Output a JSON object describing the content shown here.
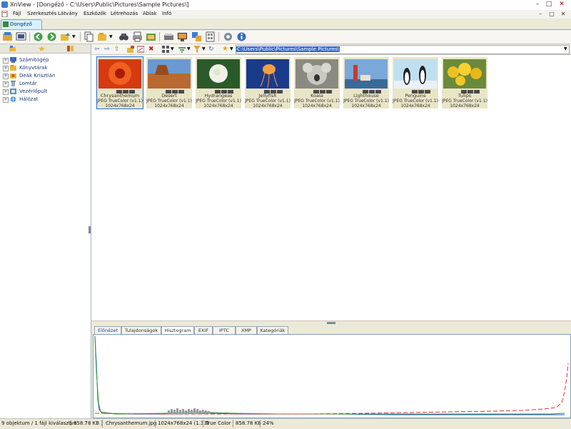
{
  "window": {
    "title": "XnView - [Dongéző - C:\\Users\\Public\\Pictures\\Sample Pictures\\]",
    "minimize": "–",
    "maximize": "□",
    "close": "✕"
  },
  "menu": [
    "Fájl",
    "Szerkesztés",
    "Látvány",
    "Eszközök",
    "Létrehozás",
    "Ablak",
    "Infó"
  ],
  "menu_window_buttons": [
    "–",
    "□",
    "✕"
  ],
  "tab": {
    "label": "Dongéző"
  },
  "path": {
    "value": "C:\\Users\\Public\\Pictures\\Sample Pictures\\"
  },
  "tree": [
    {
      "label": "Számítógép"
    },
    {
      "label": "Könyvtárak"
    },
    {
      "label": "Deák Krisztián"
    },
    {
      "label": "Lomtár"
    },
    {
      "label": "Vezérlőpult"
    },
    {
      "label": "Hálózat"
    }
  ],
  "thumbnails": [
    {
      "name": "Chrysanthemum",
      "format": "JPEG TrueColor (v1.1)",
      "dims": "1024x768x24",
      "selected": true
    },
    {
      "name": "Desert",
      "format": "JPEG TrueColor (v1.1)",
      "dims": "1024x768x24",
      "selected": false
    },
    {
      "name": "Hydrangeas",
      "format": "JPEG TrueColor (v1.1)",
      "dims": "1024x768x24",
      "selected": false
    },
    {
      "name": "Jellyfish",
      "format": "JPEG TrueColor (v1.1)",
      "dims": "1024x768x24",
      "selected": false
    },
    {
      "name": "Koala",
      "format": "JPEG TrueColor (v1.1)",
      "dims": "1024x768x24",
      "selected": false
    },
    {
      "name": "Lighthouse",
      "format": "JPEG TrueColor (v1.1)",
      "dims": "1024x768x24",
      "selected": false
    },
    {
      "name": "Penguins",
      "format": "JPEG TrueColor (v1.1)",
      "dims": "1024x768x24",
      "selected": false
    },
    {
      "name": "Tulips",
      "format": "JPEG TrueColor (v1.1)",
      "dims": "1024x768x24",
      "selected": false
    }
  ],
  "info_tabs": [
    "Előnézet",
    "Tulajdonságok",
    "Hisztogram",
    "EXIF",
    "IPTC",
    "XMP",
    "Kategóriák"
  ],
  "active_info_tab": "Hisztogram",
  "status": {
    "objects": "9 objektum / 1 fájl kiválasztva",
    "size": "[ 858.78 KB ]",
    "file": "Chrysanthemum.jpg",
    "dims": "1024x768x24 (1.33)",
    "color": "True Color",
    "filesize": "858.78 KB",
    "zoom": "24%"
  },
  "colors": {
    "accent": "#316ac5",
    "thumb_bg": "#e9e5c7",
    "hist_red": "#e03030",
    "hist_green": "#30a030",
    "hist_blue": "#3050d0"
  }
}
